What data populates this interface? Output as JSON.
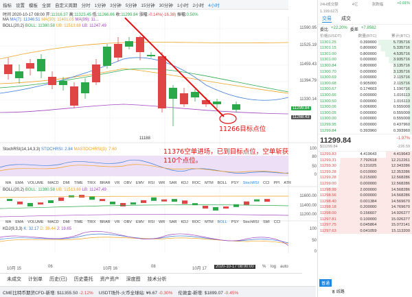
{
  "toolbar": {
    "items": [
      "指标",
      "设置",
      "模板",
      "全屏",
      "自定义周期",
      "分时",
      "1分钟",
      "3分钟",
      "5分钟",
      "15分钟",
      "30分钟",
      "1小时",
      "2小时",
      "4小时"
    ],
    "active": "4小时"
  },
  "ohlc": {
    "time": "时间 2020-10-17 08:00",
    "open_label": "开:",
    "open": "11316.37",
    "high_label": "高:",
    "high": "11323.45",
    "low_label": "低:",
    "low": "11266.66",
    "close_label": "收:",
    "close": "11299.84",
    "change_label": "涨幅:",
    "change": "-0.14%(-16.38)",
    "amp_label": "振幅:",
    "amp": "0.50%"
  },
  "ma_line": {
    "label": "MA",
    "ma7": "MA(7): 11346.51",
    "ma30": "MA(30): 11401.05",
    "ma99": "MA(99): 11..."
  },
  "boll_line": {
    "label": "BOLL(20,2)",
    "boll": "BOLL: 11380.58",
    "ub": "UB: 11513.68",
    "lb": "LB: 11247.49"
  },
  "main_axis": [
    "11590.95",
    "11525.19",
    "11459.43",
    "11394.79",
    "11330.14",
    "11299.84",
    "11268.43"
  ],
  "low_marker": "11188",
  "annotation_target": "11266目标点位",
  "annotation_main": "11376空单进场，已到目标点位，空单斩获110个点位。",
  "stochrsi": {
    "label": "StochRSI(14,14,3,3)",
    "k": "STOCHRSI: 2.84",
    "d": "MASTOCHRSI(3): 7.60",
    "axis": [
      "100",
      "80",
      "50",
      "0"
    ]
  },
  "tabs1": [
    "MA",
    "EMA",
    "VOLUME",
    "MACD",
    "DMI",
    "TIME",
    "TRIX",
    "BRAR",
    "VR",
    "OBV",
    "EMV",
    "RSI",
    "WR",
    "SAR",
    "KDJ",
    "ROC",
    "MTM",
    "BOLL",
    "PSY",
    "StochRSI",
    "CCI",
    "PPI",
    "ATR"
  ],
  "boll2": {
    "label": "BOLL(20,2)",
    "boll": "BOLL: 11380.58",
    "ub": "UB: 11513.68",
    "lb": "LB: 11247.49",
    "axis": [
      "11600.00",
      "11400.00",
      "11200.00"
    ]
  },
  "tabs2": [
    "MA",
    "EMA",
    "VOLUME",
    "MACD",
    "DMI",
    "TIME",
    "TRIX",
    "BRAR",
    "VR",
    "OBV",
    "EMV",
    "RSI",
    "WR",
    "SAR",
    "KDJ",
    "ROC",
    "MTM",
    "BOLL",
    "PSY",
    "StochRSI",
    "SMI",
    "CCI"
  ],
  "kdj": {
    "label": "KDJ(9,3,3)",
    "k": "K: 32.17",
    "d": "D: 38.44",
    "j": "J: 19.65",
    "axis": [
      "100",
      "50",
      "0"
    ]
  },
  "xaxis": [
    "10月 15",
    "06",
    "10月 16",
    "08",
    "10月 17"
  ],
  "xaxis_cursor": "2020-10-17 08:00:00",
  "xaxis_right": [
    "%",
    "log",
    "auto"
  ],
  "bottom_tabs": [
    "未成交",
    "计划单",
    "历史(已)",
    "历史委托",
    "资产资产",
    "深度图",
    "技术分析"
  ],
  "ticker": [
    {
      "label": "CME比特币期货CFD-新增:",
      "value": "$11355.50",
      "chg": "-2.12%",
      "dir": "dn"
    },
    {
      "label": "USDT场外-火币全球站:",
      "value": "¥6.67",
      "chg": "-0.30%",
      "dir": "dn"
    },
    {
      "label": "伦敦金-新增:",
      "value": "$1899.07",
      "chg": "-0.45%",
      "dir": "dn"
    }
  ],
  "panel": {
    "header_left": "24H成交额",
    "header_val": "4亿",
    "header_right_label": "涨跌幅",
    "header_right_val": "+0.01%",
    "sub_left": "1.199.62万",
    "tabs": [
      "交易",
      "成交"
    ],
    "stat1_label": "委比",
    "stat1_val": "+22.20%",
    "stat2_label": "委差",
    "stat2_val": "+7.8582",
    "cols": [
      "价格(USDT)",
      "数量(BTC)",
      "累计(BTC)"
    ],
    "sells": [
      [
        "11301.25",
        "0.399000",
        "5.735716"
      ],
      [
        "11301.15",
        "0.800000",
        "5.335716"
      ],
      [
        "11301.00",
        "0.800000",
        "4.535716"
      ],
      [
        "11301.00",
        "0.000000",
        "3.935716"
      ],
      [
        "11300.84",
        "0.800000",
        "3.135716"
      ],
      [
        "11300.70",
        "0.000000",
        "3.135716"
      ],
      [
        "11300.69",
        "0.000000",
        "2.115716"
      ],
      [
        "11300.68",
        "0.905000",
        "2.115716"
      ],
      [
        "11300.67",
        "0.174603",
        "1.190716"
      ],
      [
        "11300.66",
        "0.000000",
        "1.016113"
      ],
      [
        "11300.50",
        "0.000000",
        "1.016113"
      ],
      [
        "11300.06",
        "0.006000",
        "0.555000"
      ],
      [
        "11300.05",
        "0.000000",
        "0.555000"
      ],
      [
        "11300.00",
        "0.000000",
        "0.555000"
      ],
      [
        "11299.95",
        "0.000000",
        "0.437960"
      ],
      [
        "11299.84",
        "0.393960",
        "0.393960"
      ]
    ],
    "last_price": "11299.84",
    "last_pct": "-1.97%",
    "last_sub": "$11299.84",
    "last_diff": "-226.59",
    "buys": [
      [
        "11299.83",
        "4.419643",
        "4.419643"
      ],
      [
        "11299.31",
        "7.792618",
        "12.212261"
      ],
      [
        "11299.30",
        "0.131025",
        "12.343286"
      ],
      [
        "11299.28",
        "0.010000",
        "12.353286"
      ],
      [
        "11299.28",
        "0.215000",
        "12.568286"
      ],
      [
        "11299.00",
        "0.000000",
        "12.568286"
      ],
      [
        "11298.99",
        "2.000000",
        "14.568286"
      ],
      [
        "11298.56",
        "0.000000",
        "14.568286"
      ],
      [
        "11298.40",
        "0.001384",
        "14.569670"
      ],
      [
        "11298.18",
        "0.200000",
        "14.769670"
      ],
      [
        "11298.00",
        "0.156607",
        "14.926277"
      ],
      [
        "11297.81",
        "0.100000",
        "15.026277"
      ],
      [
        "11297.75",
        "0.045864",
        "15.072141"
      ],
      [
        "11297.63",
        "0.041059",
        "15.113200"
      ]
    ],
    "bottom_btn": "普通",
    "network": "线路"
  },
  "colors": {
    "up": "#2aa84a",
    "down": "#e04545",
    "accent": "#1e88e5",
    "annotation": "#e01010"
  }
}
